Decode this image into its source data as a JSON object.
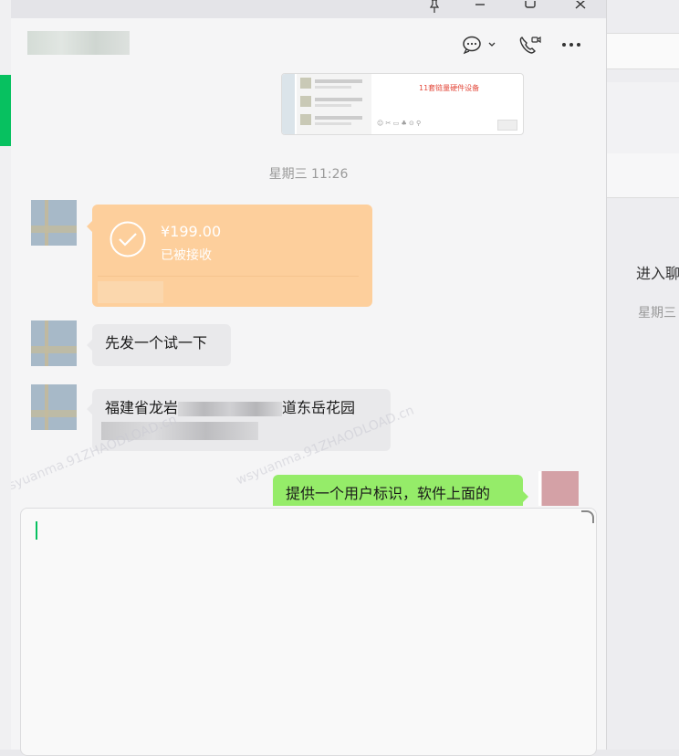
{
  "chat": {
    "screenshot_preview": {
      "red_text": "11套链量硬件设备",
      "toolbar_glyphs": "☺ ✂ ▭ ♣ ⊙ ⚲"
    },
    "timestamp": "星期三 11:26",
    "transfer": {
      "amount": "¥199.00",
      "status": "已被接收"
    },
    "messages": {
      "msg2": "先发一个试一下",
      "msg3_part1": "福建省龙岩",
      "msg3_part2": "道东岳花园",
      "msg4": "提供一个用户标识，软件上面的"
    },
    "watermark": "wsyuanma.91ZHAODLOAD.cn"
  },
  "right_window": {
    "text1": "进入聊",
    "text2": "星期三"
  },
  "colors": {
    "accent_green": "#07c160",
    "transfer_orange": "#fdcf9c",
    "outgoing_bubble": "#95ec69"
  }
}
